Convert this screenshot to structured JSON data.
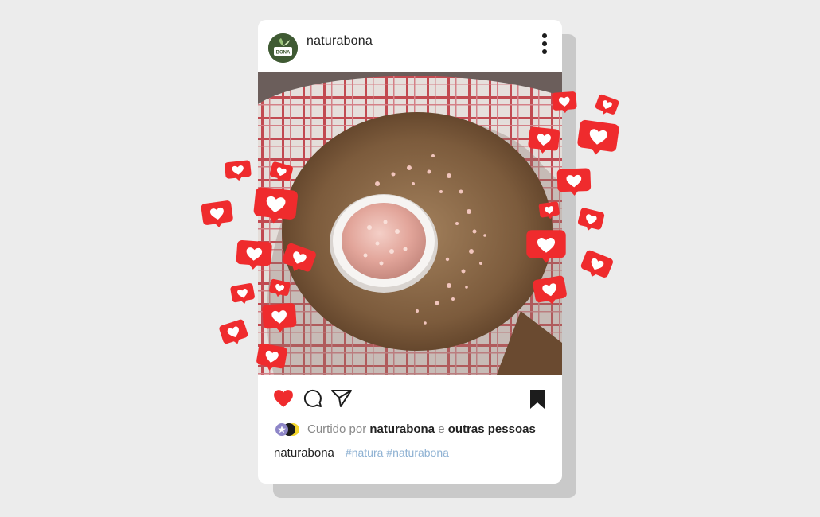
{
  "post": {
    "username": "naturabona",
    "avatar_text": "BONA",
    "icons": {
      "more": "more-vertical-icon",
      "like": "heart-filled-icon",
      "comment": "comment-bubble-icon",
      "share": "send-paper-plane-icon",
      "save": "bookmark-filled-icon"
    },
    "likes": {
      "prefix": "Curtido por",
      "user": "naturabona",
      "joiner": "e",
      "others": "outras pessoas"
    },
    "caption": {
      "user": "naturabona",
      "hashtags": "#natura #naturabona"
    }
  },
  "colors": {
    "heart_red": "#ef2b2d",
    "tag_blue": "#8fb2d3",
    "avatar_green": "#3f5a33"
  }
}
